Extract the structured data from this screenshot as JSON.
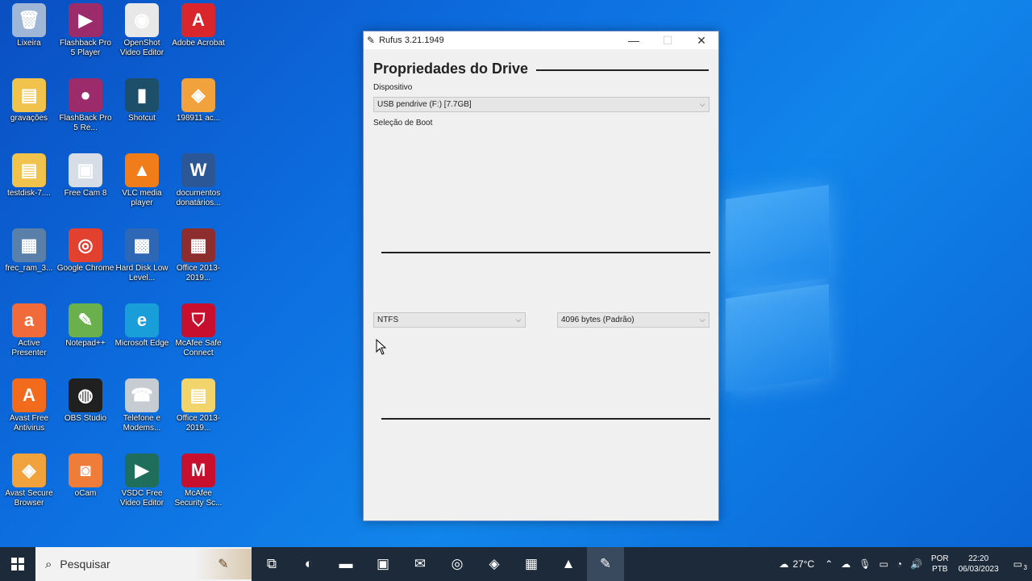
{
  "desktop": {
    "icons": [
      {
        "label": "Lixeira",
        "glyph": "🗑",
        "color": "#9fb6d6"
      },
      {
        "label": "Flashback Pro 5 Player",
        "glyph": "▶",
        "color": "#9c2b6b"
      },
      {
        "label": "OpenShot Video Editor",
        "glyph": "◉",
        "color": "#e8e8e8"
      },
      {
        "label": "Adobe Acrobat",
        "glyph": "A",
        "color": "#d8262c"
      },
      {
        "label": "gravações",
        "glyph": "▤",
        "color": "#f1c24c"
      },
      {
        "label": "FlashBack Pro 5 Re...",
        "glyph": "●",
        "color": "#9c2b6b"
      },
      {
        "label": "Shotcut",
        "glyph": "▮",
        "color": "#1d4f6b"
      },
      {
        "label": "198911 ac...",
        "glyph": "◈",
        "color": "#f1a23c"
      },
      {
        "label": "testdisk-7....",
        "glyph": "▤",
        "color": "#f1c24c"
      },
      {
        "label": "Free Cam 8",
        "glyph": "▣",
        "color": "#d7dde6"
      },
      {
        "label": "VLC media player",
        "glyph": "▲",
        "color": "#f07c1a"
      },
      {
        "label": "documentos donatários...",
        "glyph": "W",
        "color": "#2b5797"
      },
      {
        "label": "frec_ram_3...",
        "glyph": "▦",
        "color": "#5a7fa8"
      },
      {
        "label": "Google Chrome",
        "glyph": "◎",
        "color": "#e3412f"
      },
      {
        "label": "Hard Disk Low Level...",
        "glyph": "▩",
        "color": "#2e67b5"
      },
      {
        "label": "Office 2013-2019...",
        "glyph": "▦",
        "color": "#8e2d2d"
      },
      {
        "label": "Active Presenter",
        "glyph": "a",
        "color": "#f06a3a"
      },
      {
        "label": "Notepad++",
        "glyph": "✎",
        "color": "#6ab04c"
      },
      {
        "label": "Microsoft Edge",
        "glyph": "e",
        "color": "#1a9ed9"
      },
      {
        "label": "McAfee Safe Connect",
        "glyph": "⛉",
        "color": "#c8102e"
      },
      {
        "label": "Avast Free Antivirus",
        "glyph": "A",
        "color": "#f26a1b"
      },
      {
        "label": "OBS Studio",
        "glyph": "◍",
        "color": "#202020"
      },
      {
        "label": "Telefone e Modems...",
        "glyph": "☎",
        "color": "#c7ccd3"
      },
      {
        "label": "Office 2013-2019...",
        "glyph": "▤",
        "color": "#f1d46b"
      },
      {
        "label": "Avast Secure Browser",
        "glyph": "◈",
        "color": "#f1a23c"
      },
      {
        "label": "oCam",
        "glyph": "◙",
        "color": "#f07c3a"
      },
      {
        "label": "VSDC Free Video Editor",
        "glyph": "▶",
        "color": "#1f6e5c"
      },
      {
        "label": "McAfee Security Sc...",
        "glyph": "M",
        "color": "#c8102e"
      }
    ]
  },
  "window": {
    "title": "Rufus 3.21.1949",
    "minimize_glyph": "—",
    "maximize_glyph": "☐",
    "close_glyph": "✕",
    "section_title": "Propriedades do Drive",
    "device_label": "Dispositivo",
    "device_value": "USB pendrive (F:) [7.7GB]",
    "boot_label": "Seleção de Boot",
    "filesystem_value": "NTFS",
    "cluster_value": "4096 bytes (Padrão)"
  },
  "taskbar": {
    "search_placeholder": "Pesquisar",
    "apps": [
      {
        "name": "task-view",
        "glyph": "⧉"
      },
      {
        "name": "edge",
        "glyph": "◐"
      },
      {
        "name": "file-explorer",
        "glyph": "▬"
      },
      {
        "name": "store",
        "glyph": "▣"
      },
      {
        "name": "mail",
        "glyph": "✉"
      },
      {
        "name": "chrome",
        "glyph": "◎"
      },
      {
        "name": "avast-browser",
        "glyph": "◈"
      },
      {
        "name": "winrar",
        "glyph": "▦"
      },
      {
        "name": "vlc",
        "glyph": "▲"
      },
      {
        "name": "rufus",
        "glyph": "✎"
      }
    ],
    "weather": "27°C",
    "lang_top": "POR",
    "lang_bottom": "PTB",
    "time": "22:20",
    "date": "06/03/2023",
    "notification_count": "3"
  }
}
